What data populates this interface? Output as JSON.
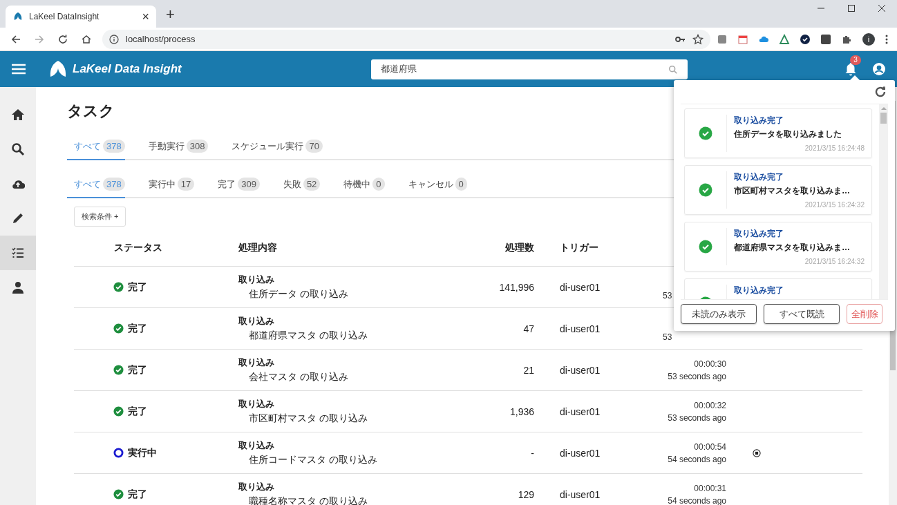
{
  "browser": {
    "tab_title": "LaKeel DataInsight",
    "tab_close": "×",
    "new_tab": "+",
    "url": "localhost/process",
    "profile_letter": "i"
  },
  "header": {
    "brand": "LaKeel Data Insight",
    "search_value": "都道府県",
    "notification_count": "3"
  },
  "sidebar": {
    "items": [
      {
        "selected": false
      },
      {
        "selected": false
      },
      {
        "selected": false
      },
      {
        "selected": false
      },
      {
        "selected": true
      },
      {
        "selected": false
      }
    ]
  },
  "page": {
    "title": "タスク",
    "trigger_tabs": [
      {
        "label": "すべて",
        "count": "378",
        "selected": true
      },
      {
        "label": "手動実行",
        "count": "308",
        "selected": false
      },
      {
        "label": "スケジュール実行",
        "count": "70",
        "selected": false
      }
    ],
    "status_tabs": [
      {
        "label": "すべて",
        "count": "378",
        "selected": true
      },
      {
        "label": "実行中",
        "count": "17",
        "selected": false
      },
      {
        "label": "完了",
        "count": "309",
        "selected": false
      },
      {
        "label": "失敗",
        "count": "52",
        "selected": false
      },
      {
        "label": "待機中",
        "count": "0",
        "selected": false
      },
      {
        "label": "キャンセル",
        "count": "0",
        "selected": false
      }
    ],
    "filter_button": "検索条件 +"
  },
  "table": {
    "columns": [
      "ステータス",
      "処理内容",
      "処理数",
      "トリガー"
    ],
    "rows": [
      {
        "status": {
          "kind": "done",
          "label": "完了"
        },
        "type": "取り込み",
        "detail": "住所データ の取り込み",
        "count": "141,996",
        "trigger": "di-user01",
        "ago": "53",
        "stoppable": false
      },
      {
        "status": {
          "kind": "done",
          "label": "完了"
        },
        "type": "取り込み",
        "detail": "都道府県マスタ の取り込み",
        "count": "47",
        "trigger": "di-user01",
        "ago": "53",
        "stoppable": false
      },
      {
        "status": {
          "kind": "done",
          "label": "完了"
        },
        "type": "取り込み",
        "detail": "会社マスタ の取り込み",
        "count": "21",
        "trigger": "di-user01",
        "duration": "00:00:30",
        "ago": "53 seconds ago",
        "stoppable": false
      },
      {
        "status": {
          "kind": "done",
          "label": "完了"
        },
        "type": "取り込み",
        "detail": "市区町村マスタ の取り込み",
        "count": "1,936",
        "trigger": "di-user01",
        "duration": "00:00:32",
        "ago": "53 seconds ago",
        "stoppable": false
      },
      {
        "status": {
          "kind": "running",
          "label": "実行中"
        },
        "type": "取り込み",
        "detail": "住所コードマスタ の取り込み",
        "count": "-",
        "trigger": "di-user01",
        "duration": "00:00:54",
        "ago": "54 seconds ago",
        "stoppable": true
      },
      {
        "status": {
          "kind": "done",
          "label": "完了"
        },
        "type": "取り込み",
        "detail": "職種名称マスタ の取り込み",
        "count": "129",
        "trigger": "di-user01",
        "duration": "00:00:31",
        "ago": "54 seconds ago",
        "stoppable": false
      }
    ]
  },
  "notifications": {
    "items": [
      {
        "kind": "success",
        "title": "取り込み完了",
        "message": "住所データを取り込みました",
        "time": "2021/3/15 16:24:48"
      },
      {
        "kind": "success",
        "title": "取り込み完了",
        "message": "市区町村マスタを取り込みま…",
        "time": "2021/3/15 16:24:32"
      },
      {
        "kind": "success",
        "title": "取り込み完了",
        "message": "都道府県マスタを取り込みま…",
        "time": "2021/3/15 16:24:32"
      },
      {
        "kind": "success",
        "title": "取り込み完了"
      }
    ],
    "buttons": [
      {
        "label": "未読のみ表示",
        "kind": "normal"
      },
      {
        "label": "すべて既読",
        "kind": "normal"
      },
      {
        "label": "全削除",
        "kind": "danger"
      }
    ]
  }
}
